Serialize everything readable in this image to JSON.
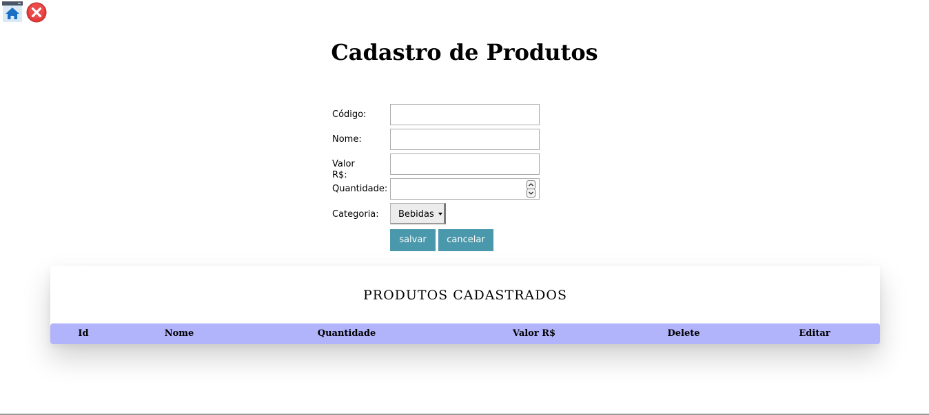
{
  "icons": {
    "home": "home-icon",
    "close": "close-icon",
    "close_color": "#e53b3b"
  },
  "header": {
    "title": "Cadastro de Produtos"
  },
  "form": {
    "codigo_label": "Código:",
    "codigo_value": "",
    "nome_label": "Nome:",
    "nome_value": "",
    "valor_label": "Valor R$:",
    "valor_value": "",
    "quantidade_label": "Quantidade:",
    "quantidade_value": "",
    "categoria_label": "Categoria:",
    "categoria_selected": "Bebidas",
    "save_label": "salvar",
    "cancel_label": "cancelar",
    "button_color": "#4a98ab"
  },
  "table": {
    "title": "PRODUTOS CADASTRADOS",
    "header_color": "#b1b3fb",
    "columns": [
      "Id",
      "Nome",
      "Quantidade",
      "Valor R$",
      "Delete",
      "Editar"
    ],
    "rows": []
  }
}
